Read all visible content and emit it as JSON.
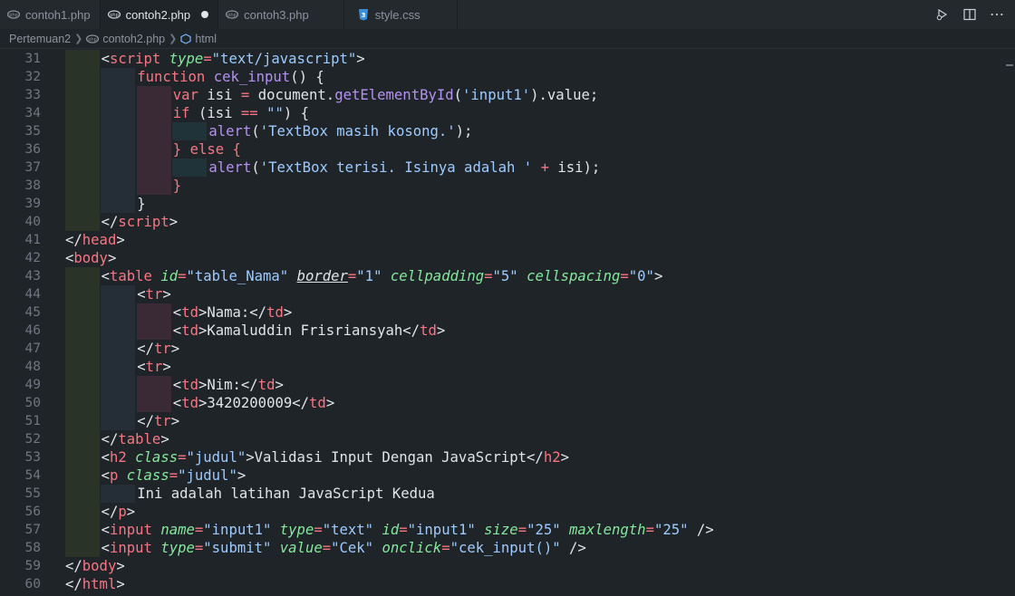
{
  "tabs": [
    {
      "label": "contoh1.php",
      "icon": "php-icon",
      "active": false
    },
    {
      "label": "contoh2.php",
      "icon": "php-icon",
      "active": true,
      "modified": true
    },
    {
      "label": "contoh3.php",
      "icon": "php-icon",
      "active": false
    },
    {
      "label": "style.css",
      "icon": "css-icon",
      "active": false
    }
  ],
  "breadcrumb": [
    "Pertemuan2",
    "contoh2.php",
    "html"
  ],
  "code_lines": [
    {
      "n": "31",
      "indent": 1
    },
    {
      "n": "32",
      "indent": 2
    },
    {
      "n": "33",
      "indent": 3
    },
    {
      "n": "34",
      "indent": 3
    },
    {
      "n": "35",
      "indent": 4
    },
    {
      "n": "36",
      "indent": 3
    },
    {
      "n": "37",
      "indent": 4
    },
    {
      "n": "38",
      "indent": 3
    },
    {
      "n": "39",
      "indent": 2
    },
    {
      "n": "40",
      "indent": 1
    },
    {
      "n": "41",
      "indent": 0
    },
    {
      "n": "42",
      "indent": 0
    },
    {
      "n": "43",
      "indent": 1
    },
    {
      "n": "44",
      "indent": 2
    },
    {
      "n": "45",
      "indent": 3
    },
    {
      "n": "46",
      "indent": 3
    },
    {
      "n": "47",
      "indent": 2
    },
    {
      "n": "48",
      "indent": 2
    },
    {
      "n": "49",
      "indent": 3
    },
    {
      "n": "50",
      "indent": 3
    },
    {
      "n": "51",
      "indent": 2
    },
    {
      "n": "52",
      "indent": 1
    },
    {
      "n": "53",
      "indent": 1
    },
    {
      "n": "54",
      "indent": 1
    },
    {
      "n": "55",
      "indent": 2
    },
    {
      "n": "56",
      "indent": 1
    },
    {
      "n": "57",
      "indent": 1
    },
    {
      "n": "58",
      "indent": 1
    },
    {
      "n": "59",
      "indent": 0
    },
    {
      "n": "60",
      "indent": 0
    }
  ],
  "code": [
    [
      [
        "b",
        "<"
      ],
      [
        "t",
        "script"
      ],
      [
        "b",
        " "
      ],
      [
        "a",
        "type"
      ],
      [
        "o",
        "="
      ],
      [
        "s",
        "\"text/javascript\""
      ],
      [
        "b",
        ">"
      ]
    ],
    [
      [
        "k",
        "function"
      ],
      [
        "b",
        " "
      ],
      [
        "f",
        "cek_input"
      ],
      [
        "b",
        "() {"
      ]
    ],
    [
      [
        "k",
        "var"
      ],
      [
        "b",
        " isi "
      ],
      [
        "o",
        "="
      ],
      [
        "b",
        " document."
      ],
      [
        "f",
        "getElementById"
      ],
      [
        "b",
        "("
      ],
      [
        "s",
        "'input1'"
      ],
      [
        "b",
        ").value;"
      ]
    ],
    [
      [
        "k",
        "if"
      ],
      [
        "b",
        " (isi "
      ],
      [
        "o",
        "=="
      ],
      [
        "b",
        " "
      ],
      [
        "s",
        "\"\""
      ],
      [
        "b",
        ") {"
      ]
    ],
    [
      [
        "f",
        "alert"
      ],
      [
        "b",
        "("
      ],
      [
        "s",
        "'TextBox masih kosong.'"
      ],
      [
        "b",
        ");"
      ]
    ],
    [
      [
        "k",
        "} else {"
      ]
    ],
    [
      [
        "f",
        "alert"
      ],
      [
        "b",
        "("
      ],
      [
        "s",
        "'TextBox terisi. Isinya adalah '"
      ],
      [
        "b",
        " "
      ],
      [
        "o",
        "+"
      ],
      [
        "b",
        " isi);"
      ]
    ],
    [
      [
        "k",
        "}"
      ]
    ],
    [
      [
        "b",
        "}"
      ]
    ],
    [
      [
        "b",
        "</"
      ],
      [
        "t",
        "script"
      ],
      [
        "b",
        ">"
      ]
    ],
    [
      [
        "b",
        "</"
      ],
      [
        "t",
        "head"
      ],
      [
        "b",
        ">"
      ]
    ],
    [
      [
        "b",
        "<"
      ],
      [
        "t",
        "body"
      ],
      [
        "b",
        ">"
      ]
    ],
    [
      [
        "b",
        "<"
      ],
      [
        "t",
        "table"
      ],
      [
        "b",
        " "
      ],
      [
        "a",
        "id"
      ],
      [
        "o",
        "="
      ],
      [
        "s",
        "\"table_Nama\""
      ],
      [
        "b",
        " "
      ],
      [
        "u",
        "border"
      ],
      [
        "o",
        "="
      ],
      [
        "s",
        "\"1\""
      ],
      [
        "b",
        " "
      ],
      [
        "a",
        "cellpadding"
      ],
      [
        "o",
        "="
      ],
      [
        "s",
        "\"5\""
      ],
      [
        "b",
        " "
      ],
      [
        "a",
        "cellspacing"
      ],
      [
        "o",
        "="
      ],
      [
        "s",
        "\"0\""
      ],
      [
        "b",
        ">"
      ]
    ],
    [
      [
        "b",
        "<"
      ],
      [
        "t",
        "tr"
      ],
      [
        "b",
        ">"
      ]
    ],
    [
      [
        "b",
        "<"
      ],
      [
        "t",
        "td"
      ],
      [
        "b",
        ">Nama:</"
      ],
      [
        "t",
        "td"
      ],
      [
        "b",
        ">"
      ]
    ],
    [
      [
        "b",
        "<"
      ],
      [
        "t",
        "td"
      ],
      [
        "b",
        ">Kamaluddin Frisriansyah</"
      ],
      [
        "t",
        "td"
      ],
      [
        "b",
        ">"
      ]
    ],
    [
      [
        "b",
        "</"
      ],
      [
        "t",
        "tr"
      ],
      [
        "b",
        ">"
      ]
    ],
    [
      [
        "b",
        "<"
      ],
      [
        "t",
        "tr"
      ],
      [
        "b",
        ">"
      ]
    ],
    [
      [
        "b",
        "<"
      ],
      [
        "t",
        "td"
      ],
      [
        "b",
        ">Nim:</"
      ],
      [
        "t",
        "td"
      ],
      [
        "b",
        ">"
      ]
    ],
    [
      [
        "b",
        "<"
      ],
      [
        "t",
        "td"
      ],
      [
        "b",
        ">3420200009</"
      ],
      [
        "t",
        "td"
      ],
      [
        "b",
        ">"
      ]
    ],
    [
      [
        "b",
        "</"
      ],
      [
        "t",
        "tr"
      ],
      [
        "b",
        ">"
      ]
    ],
    [
      [
        "b",
        "</"
      ],
      [
        "t",
        "table"
      ],
      [
        "b",
        ">"
      ]
    ],
    [
      [
        "b",
        "<"
      ],
      [
        "t",
        "h2"
      ],
      [
        "b",
        " "
      ],
      [
        "a",
        "class"
      ],
      [
        "o",
        "="
      ],
      [
        "s",
        "\"judul\""
      ],
      [
        "b",
        ">Validasi Input Dengan JavaScript</"
      ],
      [
        "t",
        "h2"
      ],
      [
        "b",
        ">"
      ]
    ],
    [
      [
        "b",
        "<"
      ],
      [
        "t",
        "p"
      ],
      [
        "b",
        " "
      ],
      [
        "a",
        "class"
      ],
      [
        "o",
        "="
      ],
      [
        "s",
        "\"judul\""
      ],
      [
        "b",
        ">"
      ]
    ],
    [
      [
        "b",
        "Ini adalah latihan JavaScript Kedua"
      ]
    ],
    [
      [
        "b",
        "</"
      ],
      [
        "t",
        "p"
      ],
      [
        "b",
        ">"
      ]
    ],
    [
      [
        "b",
        "<"
      ],
      [
        "t",
        "input"
      ],
      [
        "b",
        " "
      ],
      [
        "a",
        "name"
      ],
      [
        "o",
        "="
      ],
      [
        "s",
        "\"input1\""
      ],
      [
        "b",
        " "
      ],
      [
        "a",
        "type"
      ],
      [
        "o",
        "="
      ],
      [
        "s",
        "\"text\""
      ],
      [
        "b",
        " "
      ],
      [
        "a",
        "id"
      ],
      [
        "o",
        "="
      ],
      [
        "s",
        "\"input1\""
      ],
      [
        "b",
        " "
      ],
      [
        "a",
        "size"
      ],
      [
        "o",
        "="
      ],
      [
        "s",
        "\"25\""
      ],
      [
        "b",
        " "
      ],
      [
        "a",
        "maxlength"
      ],
      [
        "o",
        "="
      ],
      [
        "s",
        "\"25\""
      ],
      [
        "b",
        " />"
      ]
    ],
    [
      [
        "b",
        "<"
      ],
      [
        "t",
        "input"
      ],
      [
        "b",
        " "
      ],
      [
        "a",
        "type"
      ],
      [
        "o",
        "="
      ],
      [
        "s",
        "\"submit\""
      ],
      [
        "b",
        " "
      ],
      [
        "a",
        "value"
      ],
      [
        "o",
        "="
      ],
      [
        "s",
        "\"Cek\""
      ],
      [
        "b",
        " "
      ],
      [
        "a",
        "onclick"
      ],
      [
        "o",
        "="
      ],
      [
        "s",
        "\"cek_input()\""
      ],
      [
        "b",
        " />"
      ]
    ],
    [
      [
        "b",
        "</"
      ],
      [
        "t",
        "body"
      ],
      [
        "b",
        ">"
      ]
    ],
    [
      [
        "b",
        "</"
      ],
      [
        "t",
        "html"
      ],
      [
        "b",
        ">"
      ]
    ]
  ],
  "colors": {
    "background": "#1f2428",
    "tag": "#f97583",
    "attribute": "#85e89d",
    "string": "#9ecbff",
    "function": "#b392f0",
    "text": "#e1e4e8"
  }
}
